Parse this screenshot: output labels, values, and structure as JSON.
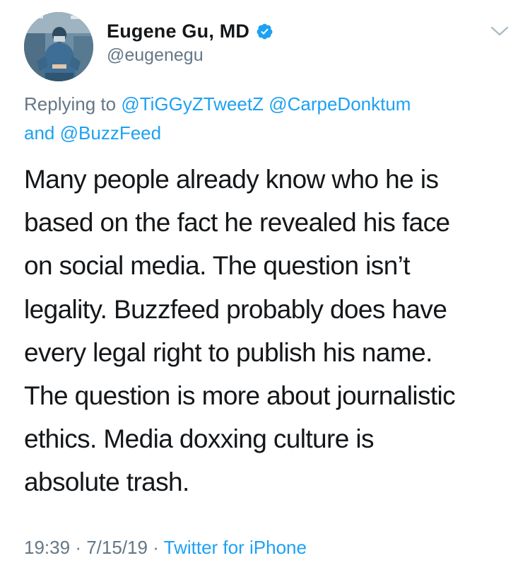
{
  "tweet": {
    "author": {
      "display_name": "Eugene Gu, MD",
      "handle": "@eugenegu",
      "verified": true,
      "avatar": "surgeon-in-operating-room"
    },
    "reply": {
      "prefix": "Replying to",
      "mentions": [
        "@TiGGyZTweetZ",
        "@CarpeDonktum",
        "@BuzzFeed"
      ],
      "conjunction": "and"
    },
    "text_lines": [
      "Many people already know who he is",
      "based on the fact he revealed his face",
      "on social media. The question isn’t",
      "legality. Buzzfeed probably does have",
      "every legal right to publish his name.",
      "The question is more about journalistic",
      "ethics. Media doxxing culture is",
      "absolute trash."
    ],
    "time": "19:39",
    "date": "7/15/19",
    "separator": "·",
    "source": "Twitter for iPhone"
  },
  "icons": {
    "verified": "verified-badge-icon",
    "menu": "chevron-down-icon"
  },
  "colors": {
    "text": "#14171a",
    "secondary": "#657786",
    "link": "#1da1f2",
    "verified": "#1da1f2",
    "background": "#ffffff"
  }
}
